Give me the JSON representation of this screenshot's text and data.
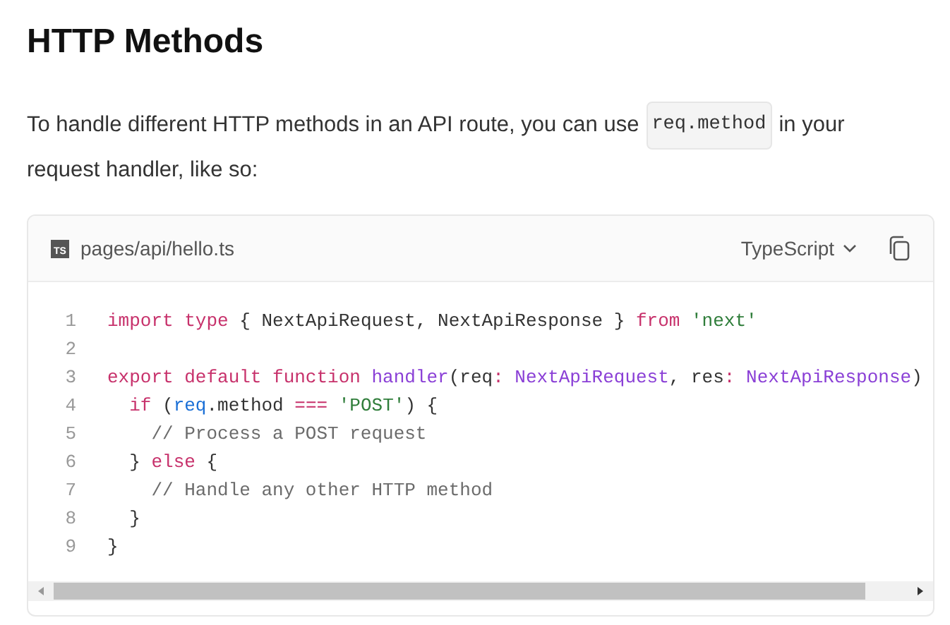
{
  "heading": "HTTP Methods",
  "paragraph_lines": [
    [
      {
        "kind": "text",
        "text": "To handle different HTTP methods in an API route, you can use"
      },
      {
        "kind": "code",
        "text": "req.method"
      },
      {
        "kind": "text",
        "text": "in your"
      }
    ],
    [
      {
        "kind": "text",
        "text": "request handler, like so:"
      }
    ]
  ],
  "code_block": {
    "filename": "pages/api/hello.ts",
    "file_badge": "TS",
    "language": "TypeScript",
    "lines": [
      {
        "number": "1",
        "tokens": [
          {
            "kind": "keyword",
            "text": "import type"
          },
          {
            "kind": "plain",
            "text": " { NextApiRequest, NextApiResponse } "
          },
          {
            "kind": "keyword",
            "text": "from"
          },
          {
            "kind": "string",
            "text": " 'next'"
          }
        ]
      },
      {
        "number": "2"
      },
      {
        "number": "3",
        "tokens": [
          {
            "kind": "keyword",
            "text": "export default function "
          },
          {
            "kind": "type",
            "text": "handler"
          },
          {
            "kind": "plain",
            "text": "(req"
          },
          {
            "kind": "keyword",
            "text": ":"
          },
          {
            "kind": "type",
            "text": " NextApiRequest"
          },
          {
            "kind": "plain",
            "text": ", res"
          },
          {
            "kind": "keyword",
            "text": ":"
          },
          {
            "kind": "type",
            "text": " NextApiResponse"
          },
          {
            "kind": "plain",
            "text": ")"
          }
        ]
      },
      {
        "number": "4",
        "tokens": [
          {
            "kind": "keyword",
            "text": "  if"
          },
          {
            "kind": "plain",
            "text": " ("
          },
          {
            "kind": "variable",
            "text": "req"
          },
          {
            "kind": "plain",
            "text": ".method "
          },
          {
            "kind": "keyword",
            "text": "=== "
          },
          {
            "kind": "string",
            "text": "'POST'"
          },
          {
            "kind": "plain",
            "text": ") {"
          }
        ]
      },
      {
        "number": "5",
        "tokens": [
          {
            "kind": "comment",
            "text": "    // Process a POST request"
          }
        ]
      },
      {
        "number": "6",
        "tokens": [
          {
            "kind": "plain",
            "text": "  } "
          },
          {
            "kind": "keyword",
            "text": "else"
          },
          {
            "kind": "plain",
            "text": " {"
          }
        ]
      },
      {
        "number": "7",
        "tokens": [
          {
            "kind": "comment",
            "text": "    // Handle any other HTTP method"
          }
        ]
      },
      {
        "number": "8",
        "tokens": [
          {
            "kind": "plain",
            "text": "  }"
          }
        ]
      },
      {
        "number": "9",
        "tokens": [
          {
            "kind": "plain",
            "text": "}"
          }
        ]
      }
    ]
  }
}
